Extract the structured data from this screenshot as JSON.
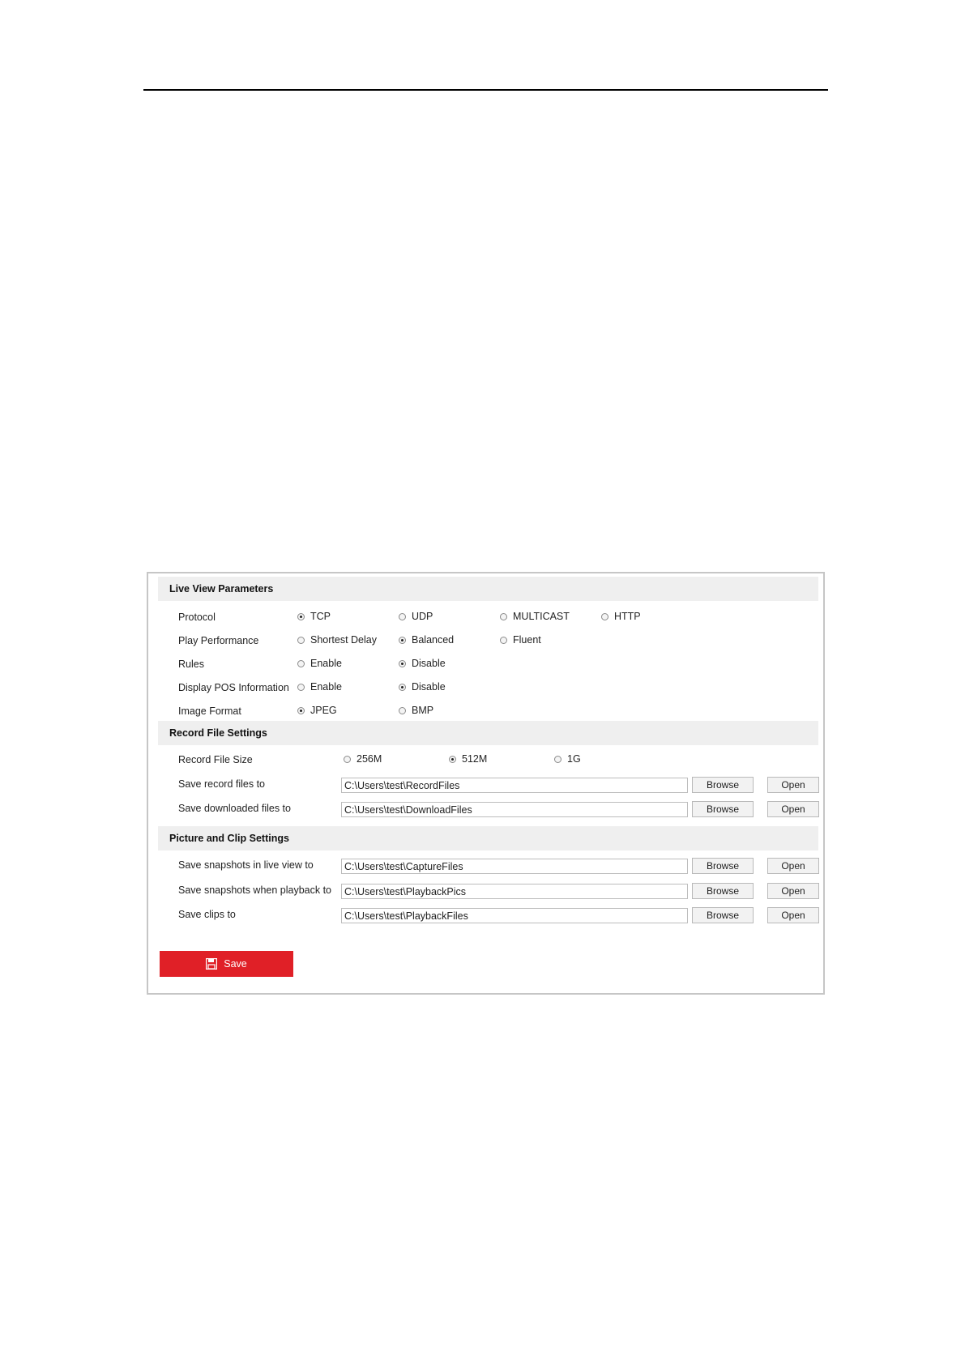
{
  "live_view": {
    "title": "Live View Parameters",
    "protocol": {
      "label": "Protocol",
      "options": [
        "TCP",
        "UDP",
        "MULTICAST",
        "HTTP"
      ],
      "selected": "TCP"
    },
    "play_performance": {
      "label": "Play Performance",
      "options": [
        "Shortest Delay",
        "Balanced",
        "Fluent"
      ],
      "selected": "Balanced"
    },
    "rules": {
      "label": "Rules",
      "options": [
        "Enable",
        "Disable"
      ],
      "selected": "Disable"
    },
    "pos_info": {
      "label": "Display POS Information",
      "options": [
        "Enable",
        "Disable"
      ],
      "selected": "Disable"
    },
    "image_format": {
      "label": "Image Format",
      "options": [
        "JPEG",
        "BMP"
      ],
      "selected": "JPEG"
    }
  },
  "record_file": {
    "title": "Record File Settings",
    "size": {
      "label": "Record File Size",
      "options": [
        "256M",
        "512M",
        "1G"
      ],
      "selected": "512M"
    },
    "save_record": {
      "label": "Save record files to",
      "value": "C:\\Users\\test\\RecordFiles"
    },
    "save_downloaded": {
      "label": "Save downloaded files to",
      "value": "C:\\Users\\test\\DownloadFiles"
    }
  },
  "picture_clip": {
    "title": "Picture and Clip Settings",
    "snap_live": {
      "label": "Save snapshots in live view to",
      "value": "C:\\Users\\test\\CaptureFiles"
    },
    "snap_playback": {
      "label": "Save snapshots when playback to",
      "value": "C:\\Users\\test\\PlaybackPics"
    },
    "clips": {
      "label": "Save clips to",
      "value": "C:\\Users\\test\\PlaybackFiles"
    }
  },
  "buttons": {
    "browse": "Browse",
    "open": "Open",
    "save": "Save"
  },
  "colors": {
    "save_button": "#e02027",
    "section_header_bg": "#efefef"
  },
  "icons": {
    "save": "floppy-disk-icon"
  }
}
